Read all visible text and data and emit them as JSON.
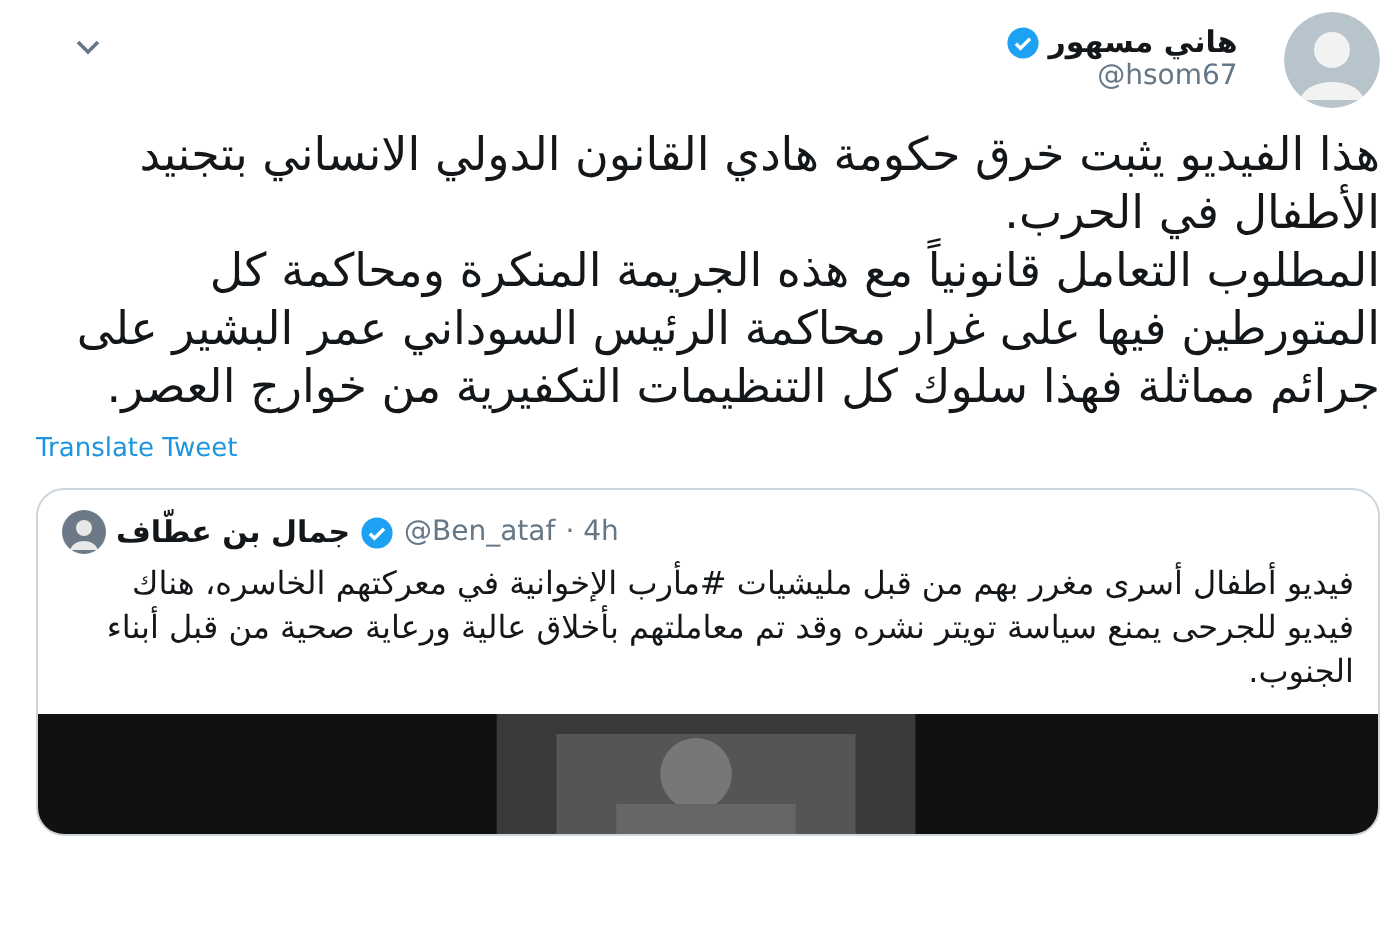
{
  "tweet": {
    "author": {
      "name": "هاني مسهور",
      "handle": "@hsom67",
      "verified": true
    },
    "paragraphs": [
      "هذا الفيديو يثبت خرق حكومة هادي القانون الدولي الانساني بتجنيد الأطفال في الحرب.",
      "المطلوب التعامل قانونياً مع هذه الجريمة المنكرة ومحاكمة كل المتورطين فيها على غرار محاكمة الرئيس السوداني عمر البشير على جرائم مماثلة فهذا سلوك كل التنظيمات التكفيرية من خوارج العصر."
    ],
    "translate_link": "Translate Tweet",
    "quoted": {
      "author": {
        "name": "جمال بن عطّاف",
        "handle": "@Ben_ataf",
        "verified": true
      },
      "time": "· 4h",
      "text": "فيديو أطفال أسرى مغرر بهم من قبل مليشيات #مأرب الإخوانية في معركتهم الخاسره، هناك فيديو للجرحى يمنع سياسة تويتر نشره وقد تم معاملتهم بأخلاق عالية ورعاية صحية من قبل أبناء الجنوب."
    }
  }
}
